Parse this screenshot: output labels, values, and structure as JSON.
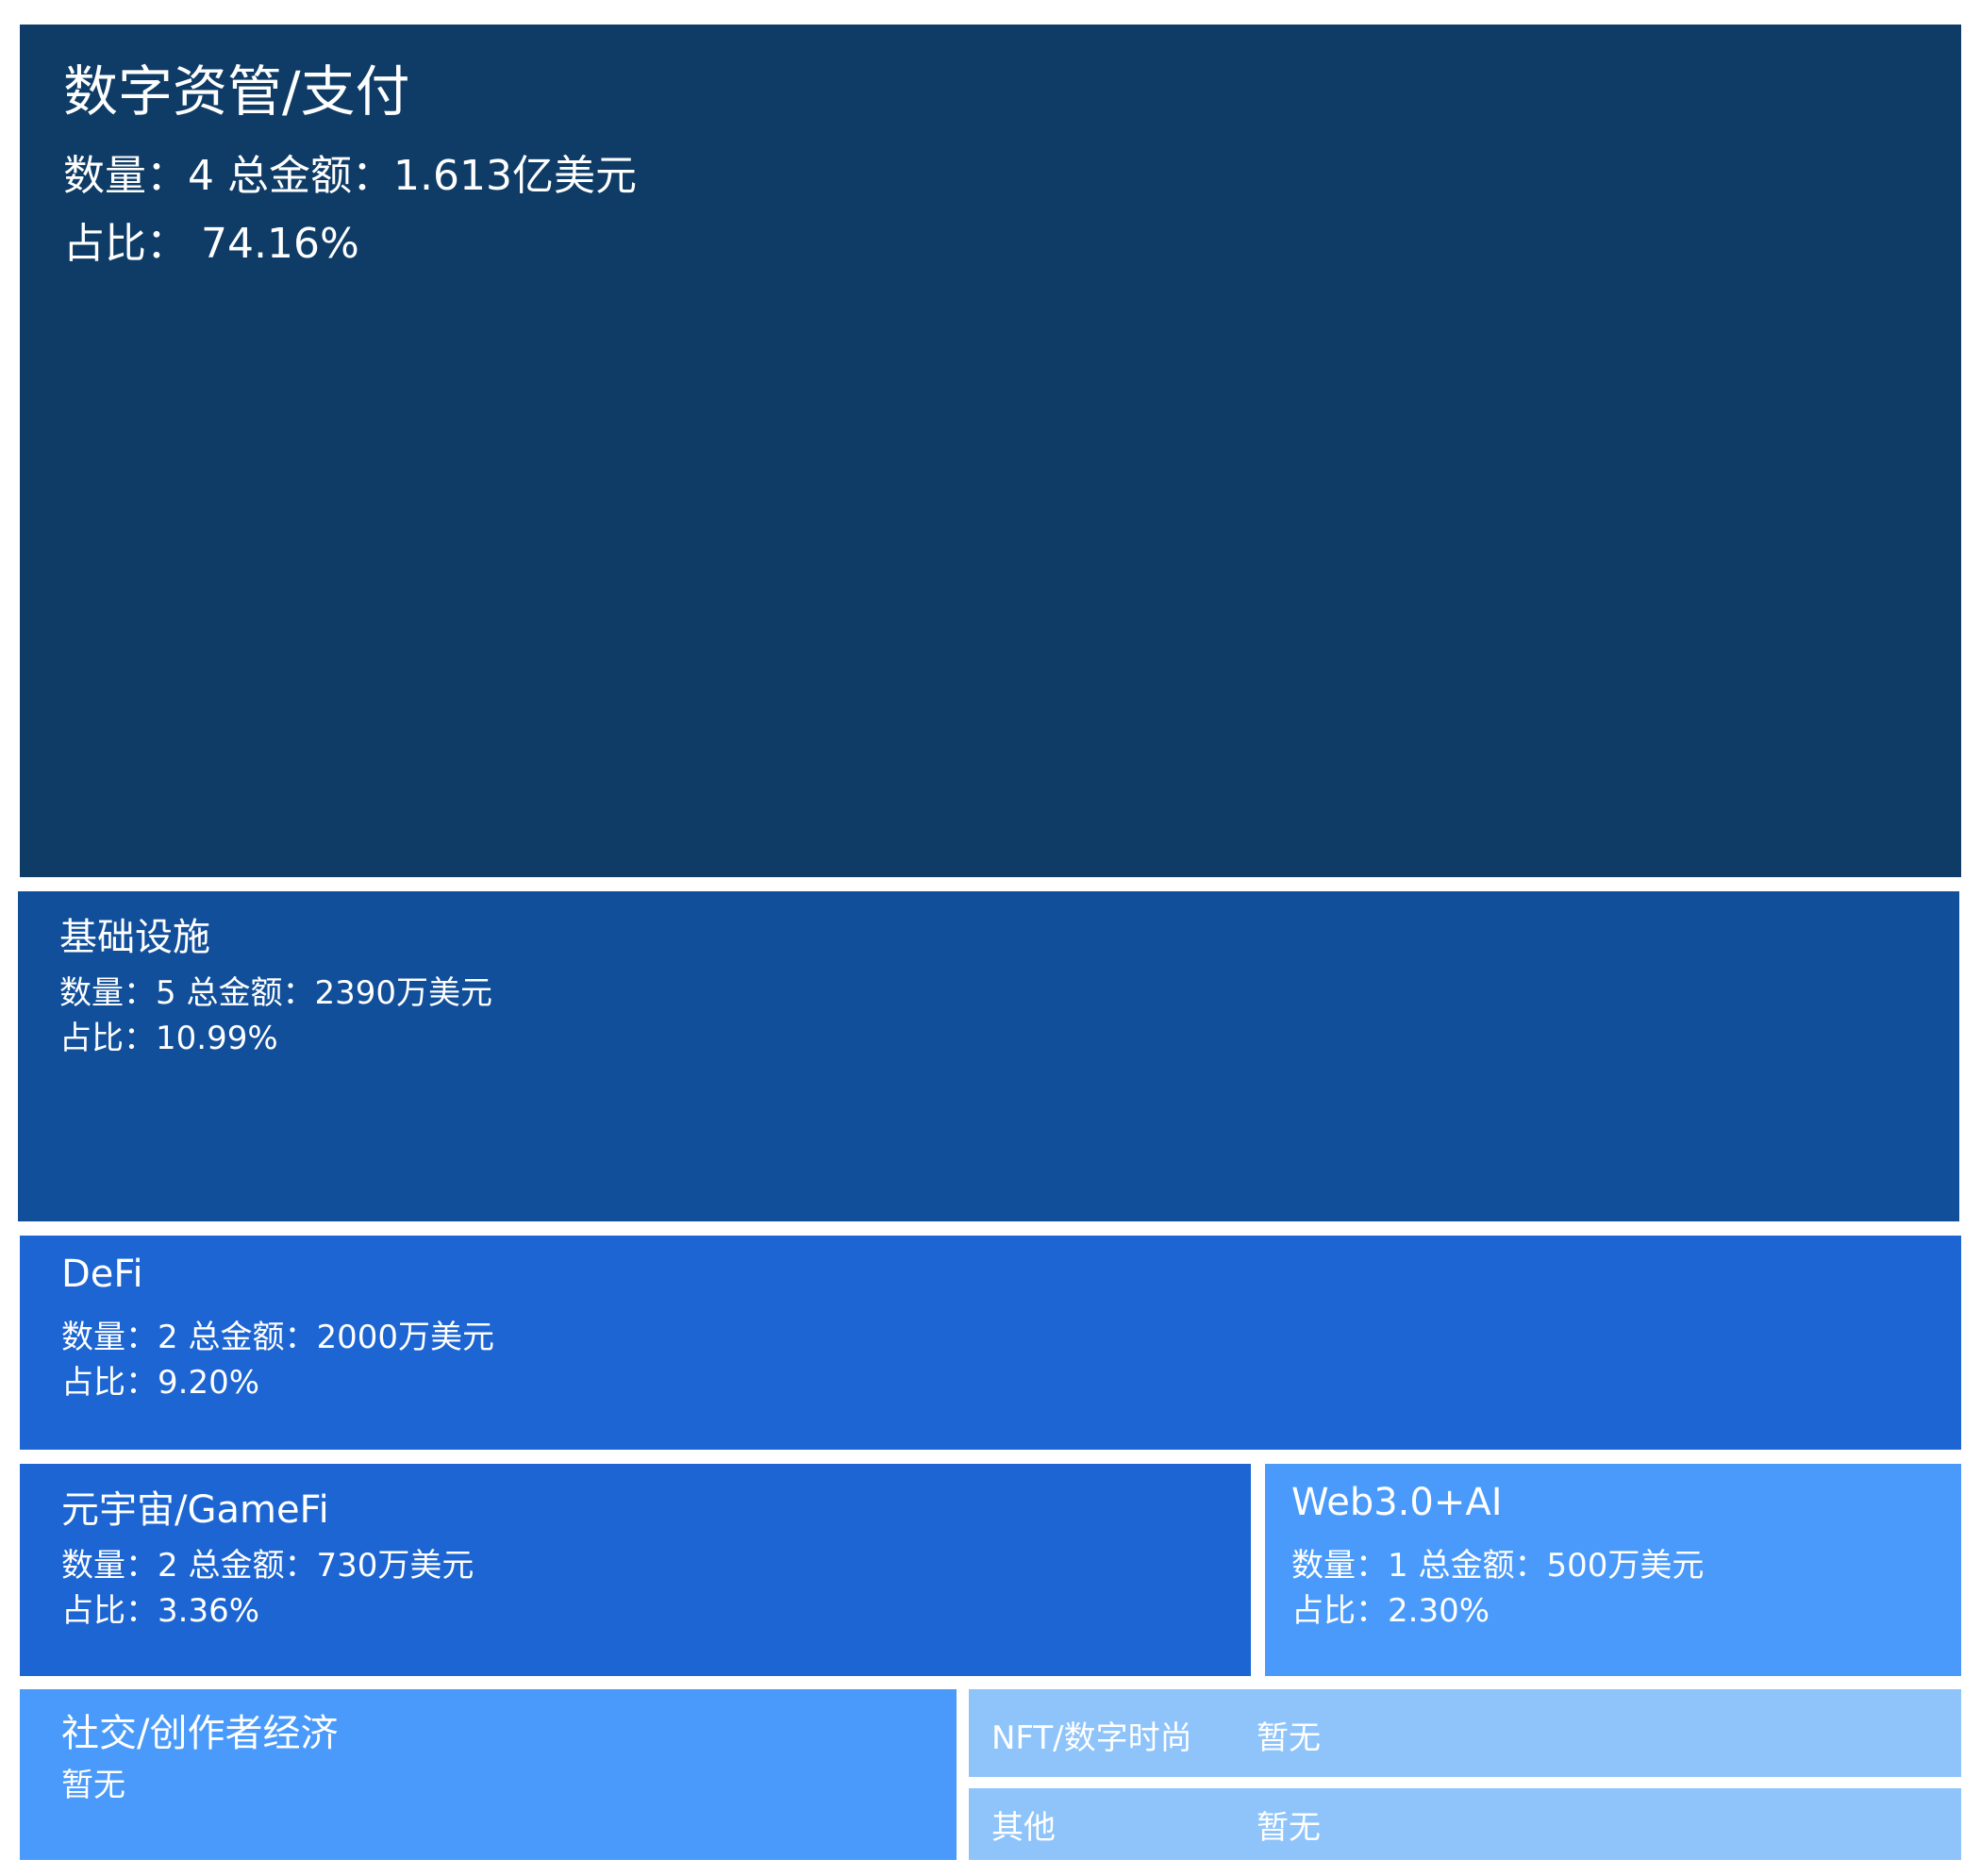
{
  "chart_data": {
    "type": "treemap",
    "title": "",
    "colors": {
      "tile_0": "#0e3c66",
      "tile_1": "#124f9a",
      "tile_2": "#1c65d2",
      "tile_3": "#1c65d2",
      "tile_4": "#4a9afb",
      "tile_5": "#4a9afb",
      "tile_6": "#8fc4fb",
      "tile_7": "#8fc4fb",
      "text": "#ffffff"
    },
    "tiles": [
      {
        "name": "数字资管/支付",
        "count": 4,
        "amount": "1.613亿美元",
        "share_pct": 74.16,
        "line1": "数量：4 总金额：1.613亿美元",
        "line2": "占比：  74.16%"
      },
      {
        "name": "基础设施",
        "count": 5,
        "amount": "2390万美元",
        "share_pct": 10.99,
        "line1": "数量：5 总金额：2390万美元",
        "line2": "占比：10.99%"
      },
      {
        "name": "DeFi",
        "count": 2,
        "amount": "2000万美元",
        "share_pct": 9.2,
        "line1": "数量：2 总金额：2000万美元",
        "line2": "占比：9.20%"
      },
      {
        "name": "元宇宙/GameFi",
        "count": 2,
        "amount": "730万美元",
        "share_pct": 3.36,
        "line1": "数量：2 总金额：730万美元",
        "line2": "占比：3.36%"
      },
      {
        "name": "Web3.0+AI",
        "count": 1,
        "amount": "500万美元",
        "share_pct": 2.3,
        "line1": "数量：1 总金额：500万美元",
        "line2": "占比：2.30%"
      },
      {
        "name": "社交/创作者经济",
        "tail": "暂无"
      },
      {
        "name": "NFT/数字时尚",
        "tail": "暂无"
      },
      {
        "name": "其他",
        "tail": "暂无"
      }
    ]
  }
}
